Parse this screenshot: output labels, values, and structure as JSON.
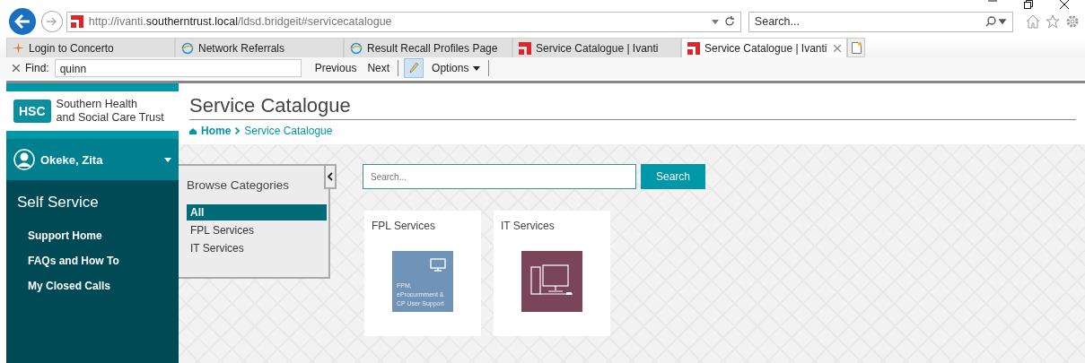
{
  "browser": {
    "url": "http://ivanti.**southerntrust.local**/ldsd.bridgeit#servicecatalogue",
    "search": {
      "placeholder": "Search..."
    },
    "tabs": [
      {
        "label": "Login to Concerto",
        "kind": "star",
        "selected": false
      },
      {
        "label": "Network Referrals",
        "kind": "globe",
        "selected": false
      },
      {
        "label": "Result Recall Profiles Page",
        "kind": "globe",
        "selected": false
      },
      {
        "label": "Service Catalogue | Ivanti",
        "kind": "ivanti",
        "selected": false
      },
      {
        "label": "Service Catalogue | Ivanti",
        "kind": "ivanti",
        "selected": true
      }
    ],
    "find": {
      "label": "Find:",
      "value": "quinn",
      "previous": "Previous",
      "next": "Next",
      "options": "Options"
    }
  },
  "sidebar": {
    "logo": "HSC",
    "org": [
      "Southern Health",
      "and Social Care Trust"
    ],
    "user": "Okeke, Zita",
    "section": "Self Service",
    "items": [
      {
        "label": "Support Home"
      },
      {
        "label": "FAQs and How To"
      },
      {
        "label": "My Closed Calls"
      }
    ]
  },
  "page": {
    "title": "Service Catalogue",
    "breadcrumb": [
      "Home",
      "Service Catalogue"
    ],
    "categories": {
      "title": "Browse Categories",
      "items": [
        {
          "label": "All",
          "selected": true
        },
        {
          "label": "FPL Services",
          "selected": false
        },
        {
          "label": "IT Services",
          "selected": false
        }
      ]
    },
    "search": {
      "placeholder": "Search...",
      "button": "Search"
    },
    "tiles": [
      {
        "title": "FPL Services",
        "color": "#7093b8",
        "kind": "monitor",
        "text": "FPM, eProcurmment & CP User Support"
      },
      {
        "title": "IT Services",
        "color": "#7a4459",
        "kind": "computer"
      }
    ]
  }
}
